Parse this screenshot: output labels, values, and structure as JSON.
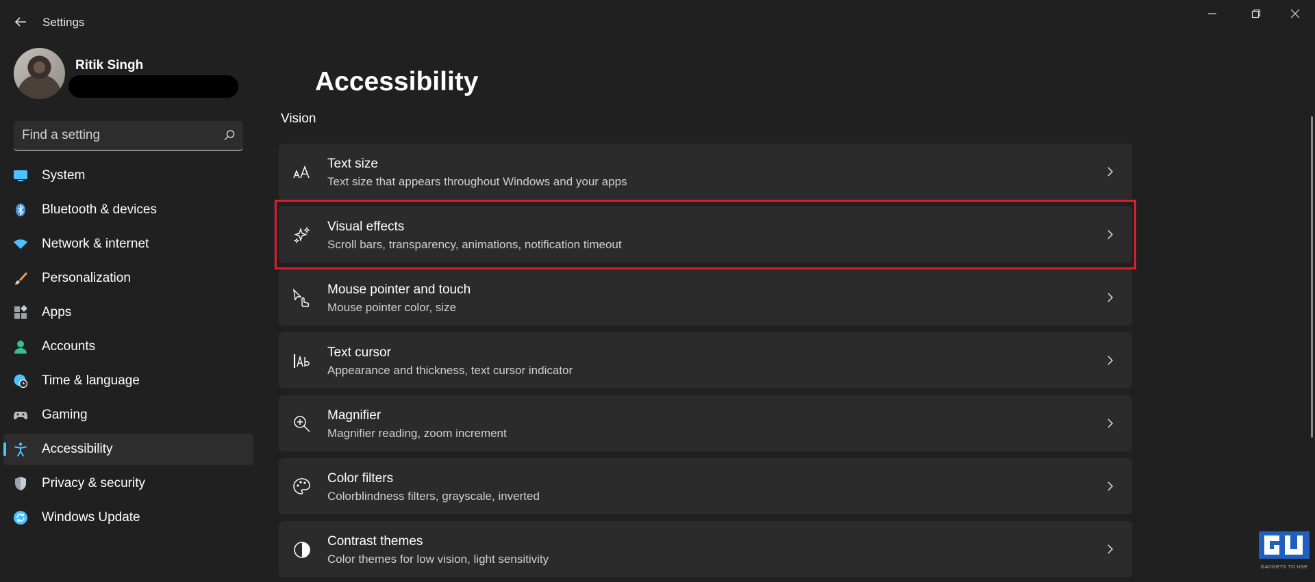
{
  "window": {
    "title": "Settings"
  },
  "profile": {
    "name": "Ritik Singh"
  },
  "search": {
    "placeholder": "Find a setting",
    "value": ""
  },
  "sidebar": {
    "active": "Accessibility",
    "items": [
      {
        "label": "System",
        "icon": "monitor-icon",
        "color": "#4cc2ff"
      },
      {
        "label": "Bluetooth & devices",
        "icon": "bluetooth-icon",
        "color": "#3a96dd"
      },
      {
        "label": "Network & internet",
        "icon": "wifi-icon",
        "color": "#4cc2ff"
      },
      {
        "label": "Personalization",
        "icon": "brush-icon",
        "color": "#e8a36a"
      },
      {
        "label": "Apps",
        "icon": "apps-icon",
        "color": "#9aa3ad"
      },
      {
        "label": "Accounts",
        "icon": "person-icon",
        "color": "#30c48d"
      },
      {
        "label": "Time & language",
        "icon": "globe-clock-icon",
        "color": "#4cc2ff"
      },
      {
        "label": "Gaming",
        "icon": "gamepad-icon",
        "color": "#b9b9b9"
      },
      {
        "label": "Accessibility",
        "icon": "accessibility-icon",
        "color": "#4cc2ff"
      },
      {
        "label": "Privacy & security",
        "icon": "shield-icon",
        "color": "#9aa3ad"
      },
      {
        "label": "Windows Update",
        "icon": "refresh-icon",
        "color": "#4cc2ff"
      }
    ]
  },
  "main": {
    "title": "Accessibility",
    "section": "Vision",
    "cards": [
      {
        "title": "Text size",
        "desc": "Text size that appears throughout Windows and your apps",
        "icon": "text-size-icon"
      },
      {
        "title": "Visual effects",
        "desc": "Scroll bars, transparency, animations, notification timeout",
        "icon": "sparkle-icon",
        "highlighted": true
      },
      {
        "title": "Mouse pointer and touch",
        "desc": "Mouse pointer color, size",
        "icon": "pointer-touch-icon"
      },
      {
        "title": "Text cursor",
        "desc": "Appearance and thickness, text cursor indicator",
        "icon": "text-cursor-icon"
      },
      {
        "title": "Magnifier",
        "desc": "Magnifier reading, zoom increment",
        "icon": "magnifier-icon"
      },
      {
        "title": "Color filters",
        "desc": "Colorblindness filters, grayscale, inverted",
        "icon": "palette-icon"
      },
      {
        "title": "Contrast themes",
        "desc": "Color themes for low vision, light sensitivity",
        "icon": "contrast-icon"
      }
    ]
  },
  "colors": {
    "background": "#202020",
    "card": "#2b2b2b",
    "accent": "#4cc2ff",
    "highlight_box": "#d9202f"
  }
}
